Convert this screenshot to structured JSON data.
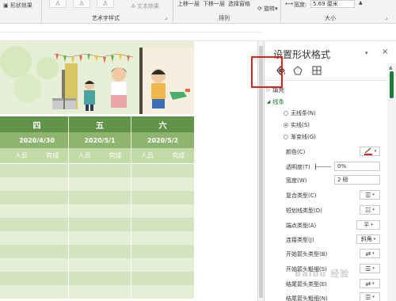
{
  "ribbon": {
    "shape_effect": "形状效果",
    "text_effect": "文本效果",
    "wordart_group": "艺术字样式",
    "bring_forward": "上移一层",
    "send_backward": "下移一层",
    "selection_pane": "选择窗格",
    "arrange_group": "排列",
    "rotate": "旋转",
    "width_label": "宽度:",
    "width_value": "5.69 厘米",
    "size_group": "大小",
    "wordart_glyph": "A",
    "launcher_glyph": "⌟",
    "dropdown_glyph": "▾"
  },
  "table": {
    "days": [
      {
        "day": "四",
        "date": "2020/4/30"
      },
      {
        "day": "五",
        "date": "2020/5/1"
      },
      {
        "day": "六",
        "date": "2020/5/2"
      }
    ],
    "col_person": "人员",
    "col_done": "完成",
    "colors": {
      "day": "#61944a",
      "date": "#8fb46f",
      "head": "#c2dba6",
      "stripe_a": "#d2e4bf",
      "stripe_b": "#e4efd6"
    }
  },
  "pane": {
    "title": "设置形状格式",
    "caret": "▾",
    "close": "×",
    "tabs": [
      "fill-line-icon",
      "effects-icon",
      "size-properties-icon"
    ],
    "fill_section": "填充",
    "line_section": "线条",
    "radios": [
      {
        "label": "无线条(N)",
        "checked": false
      },
      {
        "label": "实线(S)",
        "checked": true
      },
      {
        "label": "渐变线(G)",
        "checked": false
      }
    ],
    "props": {
      "color": "颜色(C)",
      "transparency": "透明度(T)",
      "transparency_value": "0%",
      "width": "宽度(W)",
      "width_value": "2 磅",
      "compound": "复合类型(C)",
      "dash": "短划线类型(D)",
      "cap": "端点类型(A)",
      "cap_value": "平",
      "join": "连接类型(J)",
      "join_value": "斜角",
      "begin_arrow_type": "开始箭头类型(B)",
      "begin_arrow_size": "开始箭头粗细(S)",
      "end_arrow_type": "结尾箭头类型(E)",
      "end_arrow_size": "结尾箭头粗细(N)"
    },
    "accent_color": "#1e7a3a",
    "highlight_color": "#dd2222"
  },
  "watermark": "Baidu 经验"
}
